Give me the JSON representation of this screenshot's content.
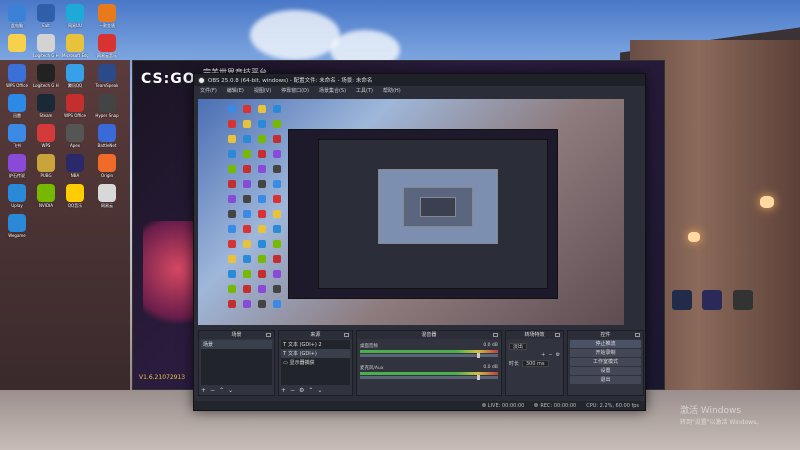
{
  "desktop_icons": [
    {
      "label": "此电脑",
      "color": "#3b82d6"
    },
    {
      "label": "Ealt",
      "color": "#2f5fa8"
    },
    {
      "label": "网易UU",
      "color": "#1ea9d8"
    },
    {
      "label": "一款金盾",
      "color": "#e87a1c"
    },
    {
      "label": "",
      "color": "#f6d24c"
    },
    {
      "label": "Logitech G HUB",
      "color": "#d3d3d3"
    },
    {
      "label": "Microsoft Edge",
      "color": "#e8c23a"
    },
    {
      "label": "网易云音乐",
      "color": "#d83232"
    },
    {
      "label": "WPS Office",
      "color": "#3a70d8"
    },
    {
      "label": "Logitech G HUB",
      "color": "#222"
    },
    {
      "label": "腾讯QQ",
      "color": "#36a0e8"
    },
    {
      "label": "TeamSpeak",
      "color": "#2b4a8a"
    },
    {
      "label": "迅雷",
      "color": "#2c8ae6"
    },
    {
      "label": "Steam",
      "color": "#1b2838"
    },
    {
      "label": "WPS Office",
      "color": "#c42e2e"
    },
    {
      "label": "Hyper Snap",
      "color": "#444"
    },
    {
      "label": "飞书",
      "color": "#3a8ae6"
    },
    {
      "label": "WPS",
      "color": "#d43a3a"
    },
    {
      "label": "Apex",
      "color": "#555"
    },
    {
      "label": "BattleNet",
      "color": "#3a6ad8"
    },
    {
      "label": "炉石传说",
      "color": "#8a4ad8"
    },
    {
      "label": "PUBG",
      "color": "#c9a43a"
    },
    {
      "label": "NBA",
      "color": "#2a2a6a"
    },
    {
      "label": "Origin",
      "color": "#f06a2a"
    },
    {
      "label": "Uplay",
      "color": "#2a8ad8"
    },
    {
      "label": "NVIDIA",
      "color": "#76b900"
    },
    {
      "label": "QQ音乐",
      "color": "#ffcc00"
    },
    {
      "label": "网易云",
      "color": "#d8d8d8"
    },
    {
      "label": "Wegame",
      "color": "#2a8ad8"
    }
  ],
  "csgo": {
    "logo": "CS:GO",
    "title": "完美世界竞技平台",
    "version": "V1.6.21072913"
  },
  "obs": {
    "title": "OBS 25.0.8 (64-bit, windows) - 配置文件: 未命名 - 场景: 未命名",
    "menu": [
      "文件(F)",
      "编辑(E)",
      "视图(V)",
      "停靠窗口(D)",
      "场景集合(S)",
      "工具(T)",
      "帮助(H)"
    ],
    "docks": {
      "scenes": {
        "title": "场景",
        "items": [
          "场景"
        ]
      },
      "sources": {
        "title": "来源",
        "items": [
          "文本 (GDI+) 2",
          "文本 (GDI+)",
          "显示器捕获"
        ]
      },
      "mixer": {
        "title": "混音器",
        "channels": [
          {
            "name": "桌面音频",
            "db": "0.0 dB"
          },
          {
            "name": "麦克风/Aux",
            "db": "0.0 dB"
          }
        ]
      },
      "transitions": {
        "title": "转场特效",
        "type": "淡出",
        "duration_label": "时长",
        "duration": "300 ms"
      },
      "controls": {
        "title": "控件",
        "buttons": [
          "停止推流",
          "开始录制",
          "工作室模式",
          "设置",
          "退出"
        ]
      }
    },
    "status": {
      "live": "LIVE: 00:00:00",
      "rec": "REC: 00:00:00",
      "cpu": "CPU: 2.2%, 60.00 fps"
    }
  },
  "watermark": {
    "line1": "激活 Windows",
    "line2": "转到\"设置\"以激活 Windows。"
  }
}
